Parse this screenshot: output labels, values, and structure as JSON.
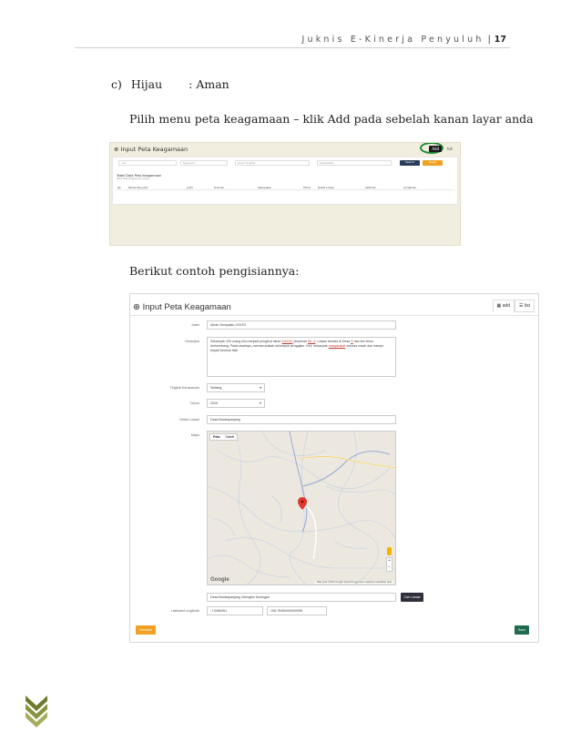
{
  "header": {
    "doc_title": "Juknis E-Kinerja Penyuluh",
    "separator": "|",
    "page_number": "17"
  },
  "body": {
    "item_c_marker": "c)",
    "item_c_label": "Hijau",
    "item_c_value": ": Aman",
    "instruction": "Pilih menu peta keagamaan – klik Add pada sebelah kanan layar anda",
    "example_intro": "Berikut contoh pengisiannya:"
  },
  "screenshot1": {
    "title": "Input Peta Keagamaan",
    "tab_add": "Add",
    "tab_list": "list",
    "filters": [
      "-All-",
      "Keyword",
      "Jenis Tingkat",
      "Kabupaten"
    ],
    "search_label": "Search",
    "reset_label": "Reset",
    "table_title": "Tabel Data Peta Keagamaan",
    "table_subtitle": "Data Peta Keagamaan Gratis",
    "columns": [
      "No",
      "Nama Penyuluh",
      "Judul",
      "Provinsi",
      "Kabupaten",
      "Tahun",
      "Detail Lokasi",
      "Latitude",
      "Longitude"
    ]
  },
  "screenshot2": {
    "title": "Input Peta Keagamaan",
    "tab_add": "add",
    "tab_list": "list",
    "labels": {
      "judul": "Judul",
      "deskripsi": "Deskripsi",
      "tingkat": "Tingkat Kerawanan",
      "tahun": "Tahun",
      "detail": "Detail Lokasi",
      "maps": "Maps",
      "latlng": "Latitude/Longitude"
    },
    "judul_value": "Aliran Sempalan XXXXX",
    "deskripsi_before": "Sebanyak 100 orang kini menjadi pengikut aliran ",
    "deskripsi_hl1": "XXXXX",
    "deskripsi_mid": " pimpinan ",
    "deskripsi_hl2": "Mr. X",
    "deskripsi_after": ". Lokasi berada di Desa ",
    "deskripsi_hl3": "X",
    "deskripsi_after2": " dan kini terus berkembang. Pada awalnya, mereka adalah kelompok pengajian. Kini, sebanyak ",
    "deskripsi_hl4": "masyarakat",
    "deskripsi_end": " merasa resah dan hampir terjadi bentrok fisik",
    "tingkat_value": "Sedang",
    "tahun_value": "2016",
    "detail_value": "Desa Bantarpanjang",
    "map_tab_map": "Peta",
    "map_tab_sat": "Satelit",
    "map_logo": "Google",
    "map_attr": "Data peta ©2016 Google   Syarat Penggunaan   Laporkan kesalahan peta",
    "address_value": "Desa Bantarpanjang Cibingbin Kuningan",
    "cari_label": "Cari Lokasi",
    "lat_value": "-7.0066391",
    "lng_value": "108.76455440000008",
    "kembali_label": "Kembali",
    "save_label": "Save"
  },
  "colors": {
    "highlight_circle": "#1f8a3a",
    "save_button": "#1e6b4f",
    "kembali_button": "#f0a023",
    "chevron": "#8a8f3a"
  }
}
